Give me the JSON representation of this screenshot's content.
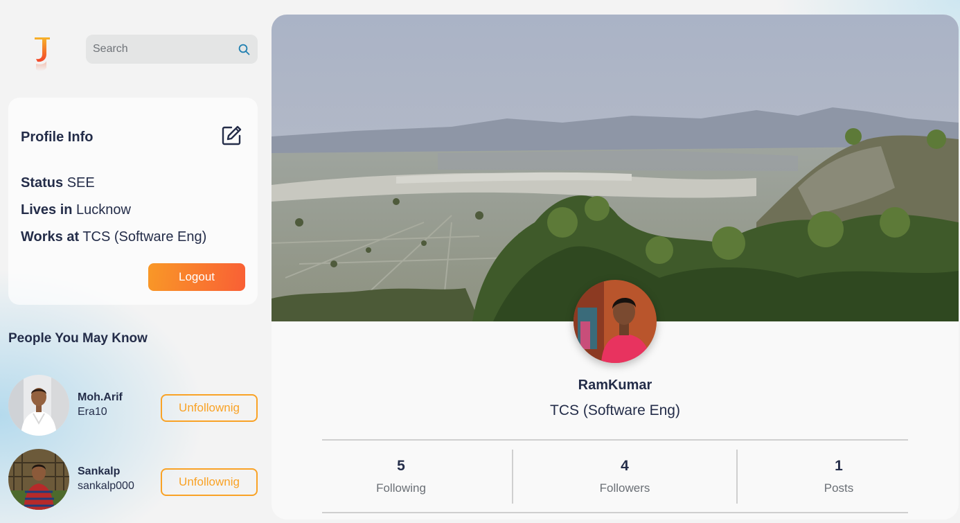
{
  "logo": {
    "letter": "J",
    "icon": "logo-j-icon"
  },
  "search": {
    "placeholder": "Search",
    "icon": "search-icon"
  },
  "profile_info": {
    "title": "Profile Info",
    "edit_icon": "edit-icon",
    "status_label": "Status",
    "status_value": "SEE",
    "lives_label": "Lives in",
    "lives_value": "Lucknow",
    "works_label": "Works at",
    "works_value": "TCS (Software Eng)",
    "logout_label": "Logout"
  },
  "people_you_may_know": {
    "title": "People You May Know",
    "people": [
      {
        "name": "Moh.Arif",
        "username": "Era10",
        "button_label": "Unfollownig"
      },
      {
        "name": "Sankalp",
        "username": "sankalp000",
        "button_label": "Unfollownig"
      }
    ]
  },
  "profile": {
    "name": "RamKumar",
    "job": "TCS (Software Eng)",
    "stats": [
      {
        "value": "5",
        "label": "Following"
      },
      {
        "value": "4",
        "label": "Followers"
      },
      {
        "value": "1",
        "label": "Posts"
      }
    ]
  },
  "colors": {
    "text_dark": "#242d49",
    "accent_orange": "#f99827",
    "accent_red": "#f95f35",
    "button_border": "#f9a225"
  }
}
